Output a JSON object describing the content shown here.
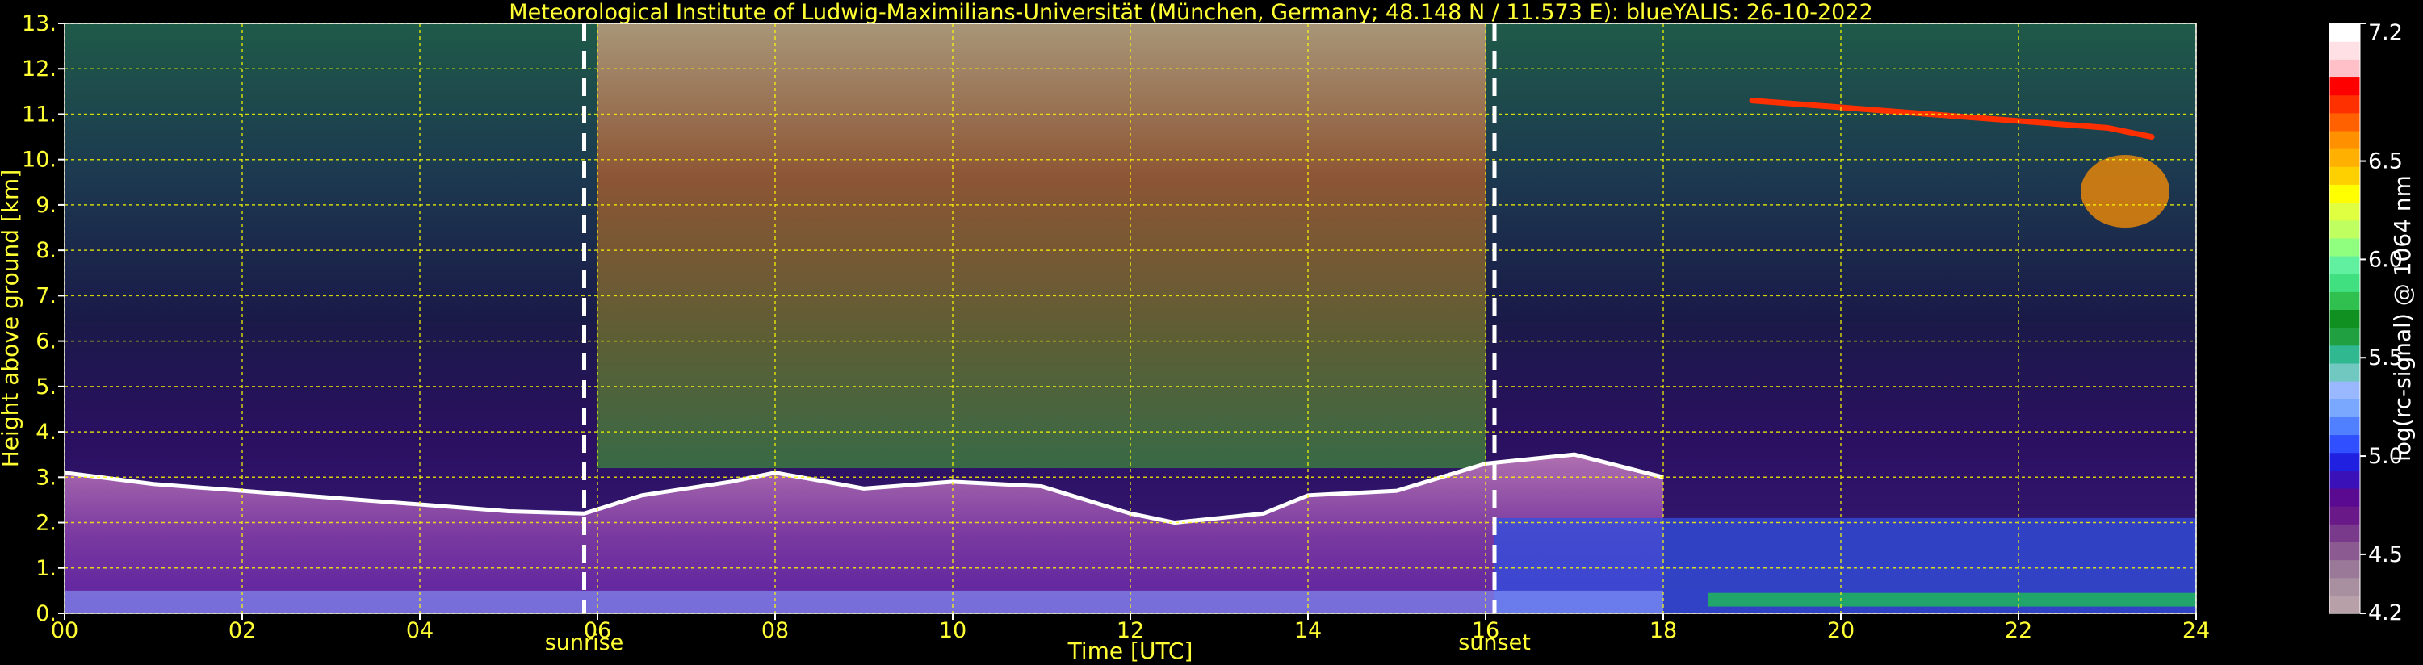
{
  "header": {
    "title": "Meteorological Institute of Ludwig-Maximilians-Universität (München, Germany; 48.148 N / 11.573 E):     blueYALIS: 26-10-2022"
  },
  "chart_data": {
    "type": "heatmap",
    "xlabel": "Time [UTC]",
    "ylabel": "Height above ground [km]",
    "x_ticks": [
      "00",
      "02",
      "04",
      "06",
      "08",
      "10",
      "12",
      "14",
      "16",
      "18",
      "20",
      "22",
      "24"
    ],
    "x_range": [
      0,
      24
    ],
    "y_ticks": [
      "0.",
      "1.",
      "2.",
      "3.",
      "4.",
      "5.",
      "6.",
      "7.",
      "8.",
      "9.",
      "10.",
      "11.",
      "12.",
      "13."
    ],
    "y_range": [
      0,
      13
    ],
    "grid": true,
    "grid_color": "#ffff00",
    "events": [
      {
        "label": "sunrise",
        "time": 5.85
      },
      {
        "label": "sunset",
        "time": 16.1
      }
    ],
    "colorbar": {
      "label": "log(rc-signal) @ 1064 nm",
      "range": [
        4.2,
        7.2
      ],
      "tick_labels": [
        "4.2",
        "4.5",
        "5.0",
        "5.5",
        "6.0",
        "6.5",
        "7.2"
      ],
      "tick_values": [
        4.2,
        4.5,
        5.0,
        5.5,
        6.0,
        6.5,
        7.2
      ],
      "colors": [
        "#b8a0a8",
        "#a890a0",
        "#9a7898",
        "#8a5a90",
        "#7a3a8c",
        "#6a1a88",
        "#5a0a90",
        "#3a10b8",
        "#2020e0",
        "#3050ff",
        "#5080ff",
        "#7aa8ff",
        "#9ab8ff",
        "#70c8c0",
        "#30b890",
        "#20a040",
        "#109020",
        "#30c050",
        "#40e080",
        "#60f0a0",
        "#90ff80",
        "#c0ff60",
        "#e0ff40",
        "#ffff00",
        "#ffd000",
        "#ffb000",
        "#ff9000",
        "#ff6000",
        "#ff3000",
        "#ff0000",
        "#ffc0c8",
        "#ffe0e4",
        "#ffffff"
      ]
    },
    "features": {
      "boundary_layer_top": [
        [
          0,
          3.1
        ],
        [
          1,
          2.85
        ],
        [
          2,
          2.7
        ],
        [
          3,
          2.55
        ],
        [
          4,
          2.4
        ],
        [
          5,
          2.25
        ],
        [
          5.85,
          2.2
        ],
        [
          6.5,
          2.6
        ],
        [
          7.5,
          2.9
        ],
        [
          8,
          3.1
        ],
        [
          9,
          2.75
        ],
        [
          10,
          2.9
        ],
        [
          11,
          2.8
        ],
        [
          12,
          2.2
        ],
        [
          12.5,
          2.0
        ],
        [
          13.5,
          2.2
        ],
        [
          14,
          2.6
        ],
        [
          15,
          2.7
        ],
        [
          16,
          3.3
        ],
        [
          17,
          3.5
        ],
        [
          18,
          3.0
        ]
      ],
      "high_cloud": [
        [
          19,
          11.3
        ],
        [
          20,
          11.15
        ],
        [
          21,
          11.0
        ],
        [
          22,
          10.85
        ],
        [
          23,
          10.7
        ],
        [
          23.5,
          10.5
        ]
      ]
    }
  }
}
